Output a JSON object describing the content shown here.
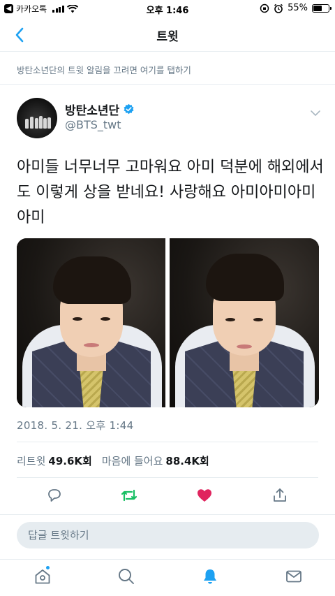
{
  "status_bar": {
    "back_app_label": "카카오톡",
    "time": "오후 1:46",
    "battery_text": "55%",
    "battery_level": 0.55
  },
  "nav": {
    "title": "트윗"
  },
  "notify_link": "방탄소년단의 트윗 알림을 끄려면 여기를 탭하기",
  "author": {
    "name": "방탄소년단",
    "handle": "@BTS_twt",
    "verified_icon": "verified-badge-icon"
  },
  "tweet": {
    "text": "아미들 너무너무 고마워요 아미 덕분에 해외에서도 이렇게 상을 받네요! 사랑해요 아미아미아미아미",
    "timestamp": "2018. 5. 21. 오후 1:44",
    "media_count": 2
  },
  "stats": {
    "retweets_label": "리트윗",
    "retweets_value": "49.6K회",
    "likes_label": "마음에 들어요",
    "likes_value": "88.4K회"
  },
  "actions": {
    "reply_icon": "reply-icon",
    "retweet_icon": "retweet-icon",
    "like_icon": "heart-icon",
    "share_icon": "share-icon",
    "retweet_color": "#17bf63",
    "like_color": "#e0245e"
  },
  "reply_bar": {
    "placeholder": "답글 트윗하기"
  },
  "tabbar": {
    "items": [
      "home-icon",
      "search-icon",
      "notifications-icon",
      "messages-icon"
    ],
    "active": "notifications-icon",
    "accent": "#1da1f2"
  }
}
